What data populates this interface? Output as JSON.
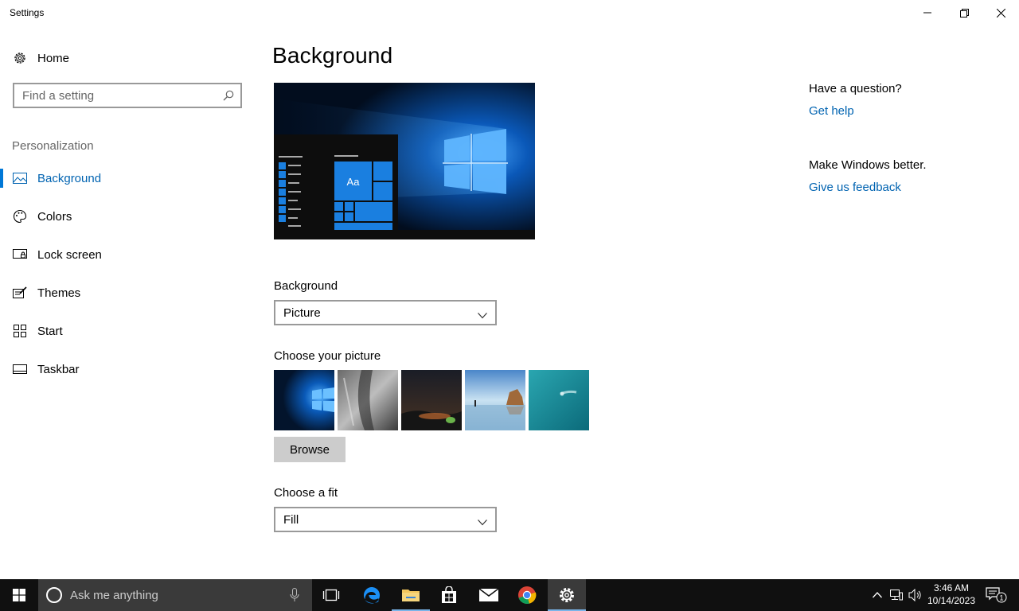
{
  "window": {
    "title": "Settings"
  },
  "sidebar": {
    "home_label": "Home",
    "search_placeholder": "Find a setting",
    "section_title": "Personalization",
    "items": [
      {
        "label": "Background",
        "icon": "picture-icon",
        "active": true
      },
      {
        "label": "Colors",
        "icon": "palette-icon"
      },
      {
        "label": "Lock screen",
        "icon": "lock-screen-icon"
      },
      {
        "label": "Themes",
        "icon": "themes-icon"
      },
      {
        "label": "Start",
        "icon": "start-icon"
      },
      {
        "label": "Taskbar",
        "icon": "taskbar-icon"
      }
    ]
  },
  "main": {
    "title": "Background",
    "preview_tile_text": "Aa",
    "background_label": "Background",
    "background_value": "Picture",
    "choose_picture_label": "Choose your picture",
    "browse_label": "Browse",
    "choose_fit_label": "Choose a fit",
    "fit_value": "Fill"
  },
  "help": {
    "question": "Have a question?",
    "get_help": "Get help",
    "better": "Make Windows better.",
    "feedback": "Give us feedback"
  },
  "taskbar": {
    "search_text": "Ask me anything",
    "time": "3:46 AM",
    "date": "10/14/2023",
    "notification_count": "1"
  },
  "colors": {
    "accent": "#0078d7",
    "link": "#0063b1",
    "taskbar": "#101010"
  }
}
